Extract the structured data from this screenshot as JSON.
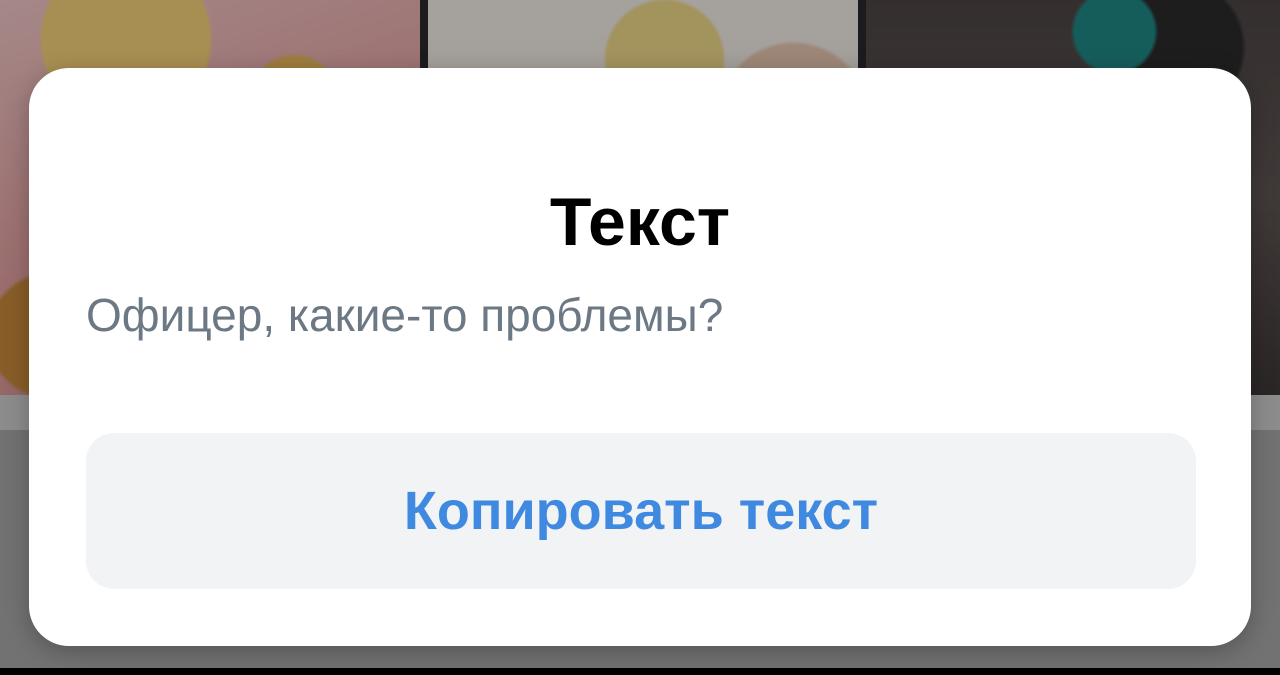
{
  "dialog": {
    "title": "Текст",
    "message": "Офицер, какие-то проблемы?",
    "copy_button_label": "Копировать текст"
  },
  "colors": {
    "title": "#000000",
    "message": "#6d7885",
    "button_text": "#3f8ae0",
    "button_bg": "#f2f3f5",
    "dialog_bg": "#ffffff"
  }
}
